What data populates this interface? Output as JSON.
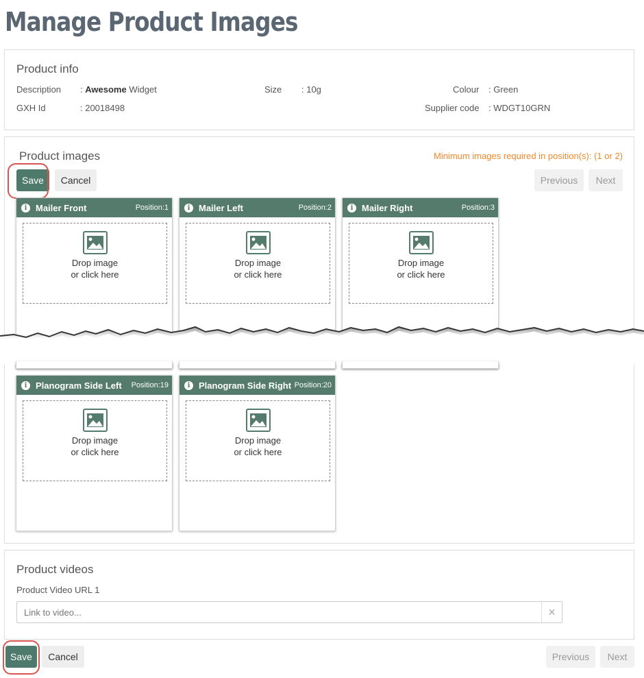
{
  "page": {
    "title": "Manage Product Images"
  },
  "product_info": {
    "heading": "Product info",
    "description_label": "Description",
    "description_bold": "Awesome",
    "description_rest": " Widget",
    "size_label": "Size",
    "size_value": ": 10g",
    "colour_label": "Colour",
    "colour_value": ": Green",
    "gxh_label": "GXH Id",
    "gxh_value": ": 20018498",
    "supplier_label": "Supplier code",
    "supplier_value": ": WDGT10GRN",
    "colon": ": "
  },
  "images": {
    "heading": "Product images",
    "min_warning": "Minimum images required in position(s): (1 or 2)",
    "save_label": "Save",
    "cancel_label": "Cancel",
    "previous_label": "Previous",
    "next_label": "Next",
    "drop_line1": "Drop image",
    "drop_line2": "or click here",
    "cards": [
      {
        "title": "Mailer Front",
        "position": "Position:1"
      },
      {
        "title": "Mailer Left",
        "position": "Position:2"
      },
      {
        "title": "Mailer Right",
        "position": "Position:3"
      },
      {
        "title": "Planogram Side Left",
        "position": "Position:19"
      },
      {
        "title": "Planogram Side Right",
        "position": "Position:20"
      }
    ]
  },
  "videos": {
    "heading": "Product videos",
    "url_label": "Product Video URL 1",
    "url_value": "",
    "url_placeholder": "Link to video...",
    "clear_glyph": "✕"
  },
  "footer": {
    "save_label": "Save",
    "cancel_label": "Cancel",
    "previous_label": "Previous",
    "next_label": "Next"
  },
  "colors": {
    "primary": "#4e7a6b",
    "card_header": "#557b6c",
    "warning": "#f0892a",
    "highlight": "#d9534f"
  },
  "icons": {
    "info": "info-icon",
    "image": "image-icon",
    "clear": "clear-icon"
  }
}
